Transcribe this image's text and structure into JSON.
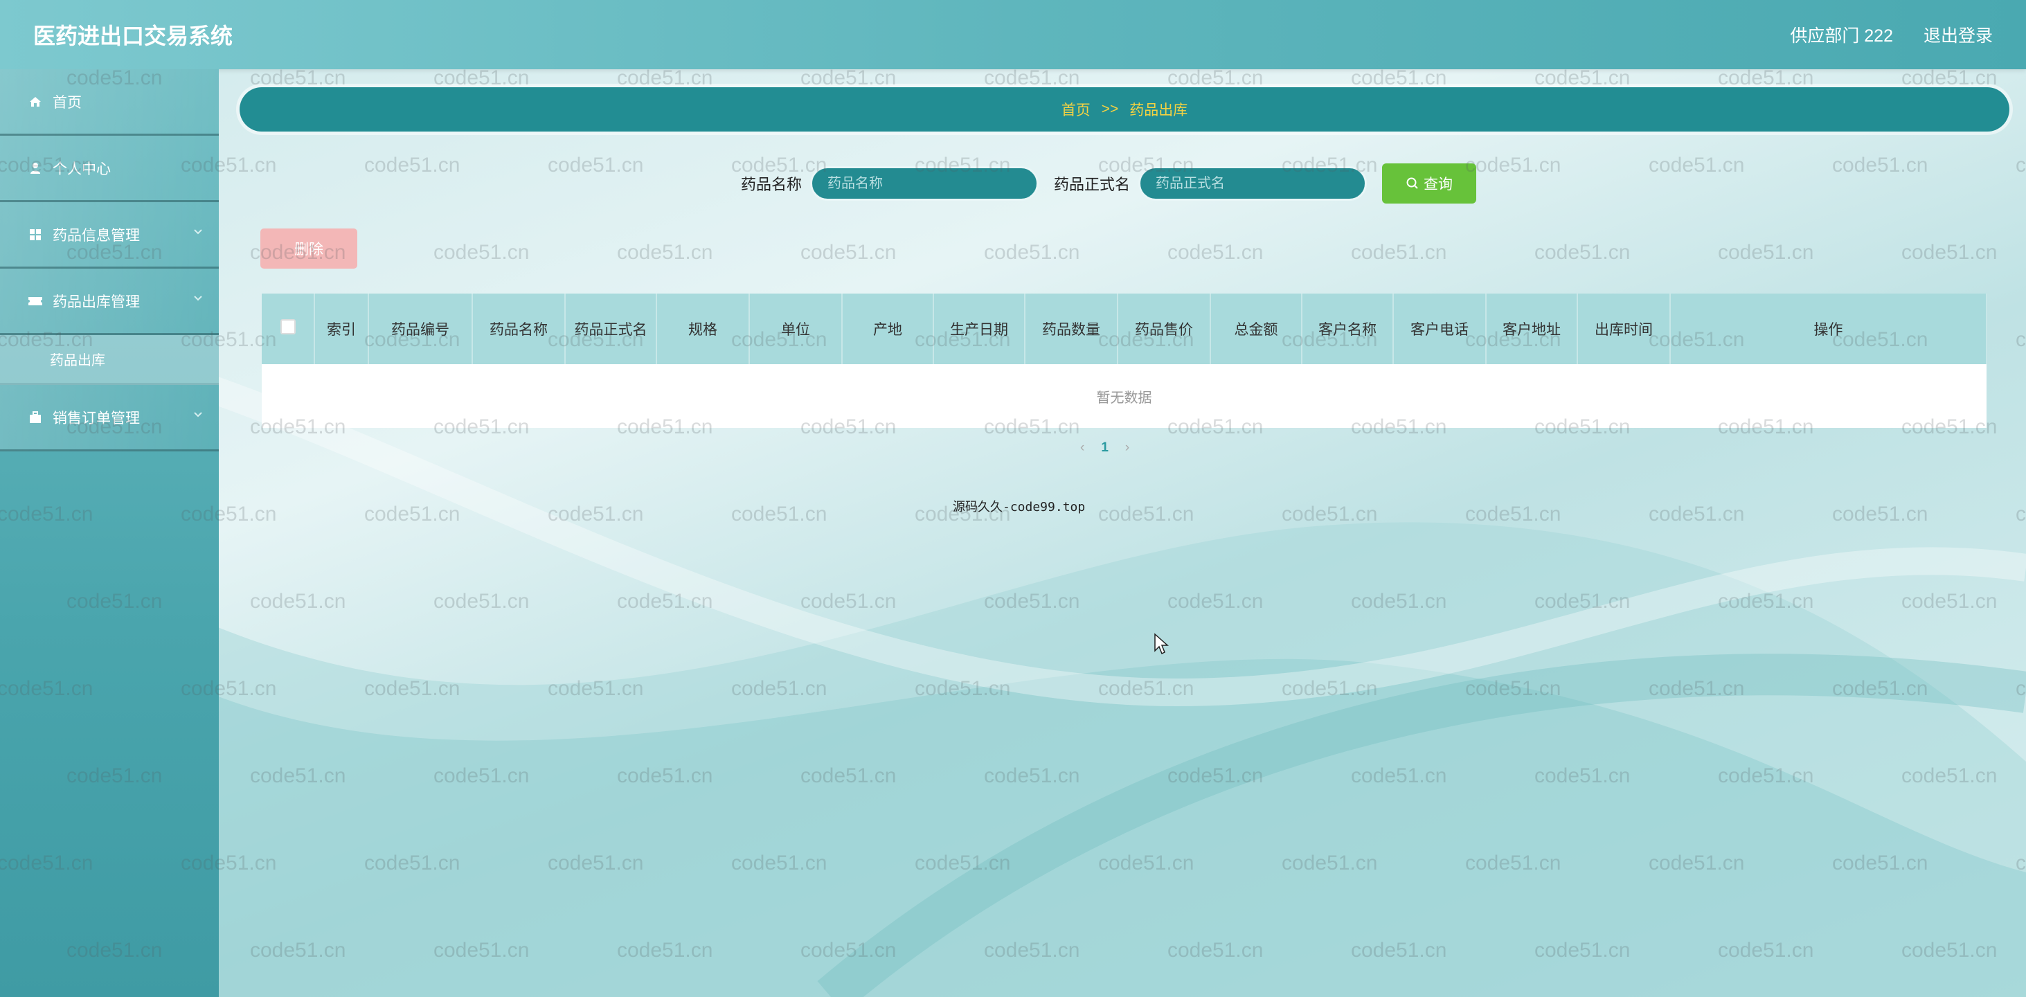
{
  "app": {
    "title": "医药进出口交易系统"
  },
  "header": {
    "user": "供应部门 222",
    "logout": "退出登录"
  },
  "sidebar": {
    "items": [
      {
        "label": "首页",
        "icon": "home-icon"
      },
      {
        "label": "个人中心",
        "icon": "user-icon"
      },
      {
        "label": "药品信息管理",
        "icon": "grid-icon"
      },
      {
        "label": "药品出库管理",
        "icon": "ticket-icon"
      },
      {
        "label": "销售订单管理",
        "icon": "briefcase-icon"
      }
    ],
    "submenu": {
      "label": "药品出库"
    }
  },
  "breadcrumb": {
    "home": "首页",
    "sep": ">>",
    "current": "药品出库"
  },
  "search": {
    "name_label": "药品名称",
    "name_placeholder": "药品名称",
    "formal_label": "药品正式名",
    "formal_placeholder": "药品正式名",
    "button": "查询"
  },
  "actions": {
    "delete": "删除"
  },
  "table": {
    "columns": [
      "索引",
      "药品编号",
      "药品名称",
      "药品正式名",
      "规格",
      "单位",
      "产地",
      "生产日期",
      "药品数量",
      "药品售价",
      "总金额",
      "客户名称",
      "客户电话",
      "客户地址",
      "出库时间",
      "操作"
    ],
    "empty_text": "暂无数据"
  },
  "pagination": {
    "current": "1"
  },
  "footer": {
    "note": "源码久久-code99.top"
  },
  "watermark": {
    "text": "code51.cn"
  },
  "colors": {
    "accent": "#228d93",
    "breadcrumb_text": "#f4d242",
    "search_button": "#67c23a",
    "delete_button": "#f3b7b7"
  }
}
